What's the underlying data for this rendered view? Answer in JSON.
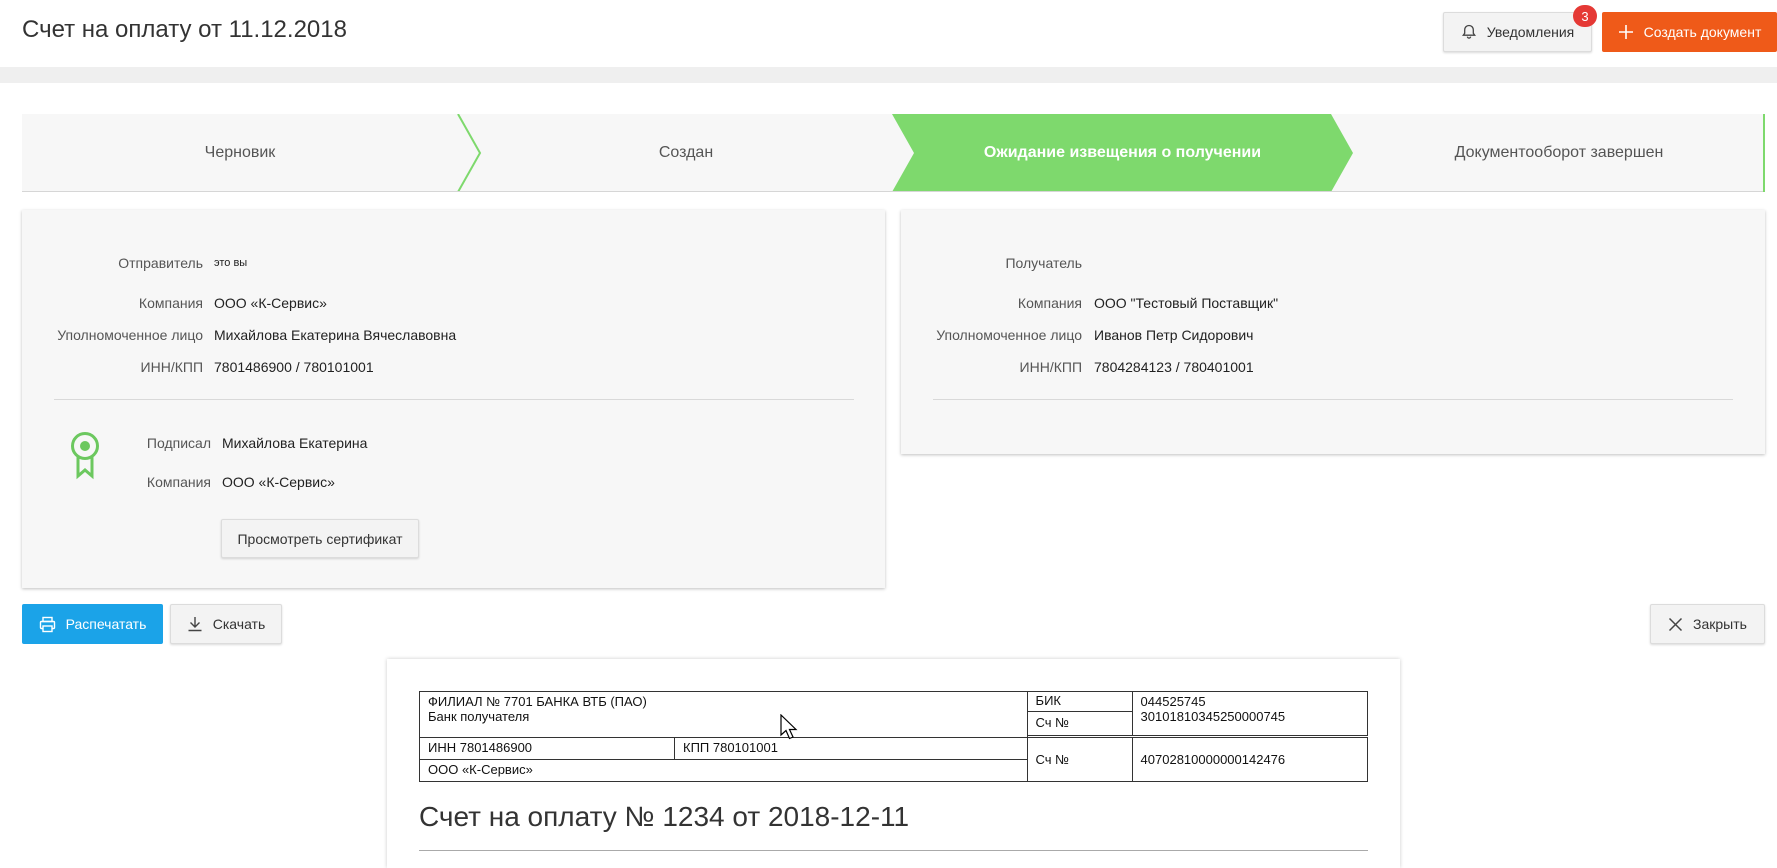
{
  "header": {
    "title": "Счет на оплату от 11.12.2018",
    "notifications_label": "Уведомления",
    "notifications_count": "3",
    "create_label": "Создать документ"
  },
  "stepper": {
    "steps": [
      "Черновик",
      "Создан",
      "Ожидание извещения о получении",
      "Документооборот завершен"
    ],
    "active_index": 2,
    "active_color": "#7ed96d"
  },
  "sender": {
    "role_label": "Отправитель",
    "role_value": "это вы",
    "company_label": "Компания",
    "company_value": "ООО «К-Сервис»",
    "person_label": "Уполномоченное лицо",
    "person_value": "Михайлова Екатерина Вячеславовна",
    "inn_label": "ИНН/КПП",
    "inn_value": "7801486900 / 780101001",
    "signed_label": "Подписал",
    "signed_value": "Михайлова Екатерина",
    "signed_company_label": "Компания",
    "signed_company_value": "ООО «К-Сервис»",
    "cert_button": "Просмотреть сертификат"
  },
  "receiver": {
    "role_label": "Получатель",
    "company_label": "Компания",
    "company_value": "ООО \"Тестовый Поставщик\"",
    "person_label": "Уполномоченное лицо",
    "person_value": "Иванов Петр Сидорович",
    "inn_label": "ИНН/КПП",
    "inn_value": "7804284123 / 780401001"
  },
  "actions": {
    "print": "Распечатать",
    "download": "Скачать",
    "close": "Закрыть"
  },
  "document": {
    "bank_name": "ФИЛИАЛ № 7701 БАНКА ВТБ (ПАО)",
    "bank_label": "Банк получателя",
    "bik_label": "БИК",
    "bik_value": "044525745",
    "corr_label": "Сч №",
    "corr_value": "30101810345250000745",
    "inn": "ИНН 7801486900",
    "kpp": "КПП 780101001",
    "account_label": "Сч №",
    "account_value": "40702810000000142476",
    "recipient": "ООО «К-Сервис»",
    "title": "Счет на оплату № 1234 от 2018-12-11"
  }
}
